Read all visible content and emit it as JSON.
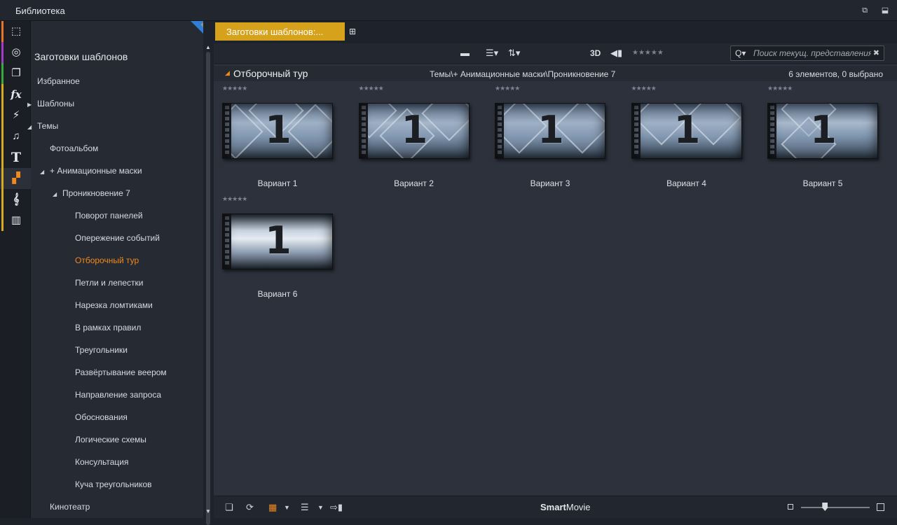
{
  "window": {
    "title": "Библиотека",
    "restore_icon": "restore-icon",
    "detach_icon": "detach-window-icon"
  },
  "categories": [
    {
      "icon": "project-box-icon",
      "glyph": "⬚",
      "color": "#e8742a"
    },
    {
      "icon": "film-reel-icon",
      "glyph": "◎",
      "color": "#a23bc8"
    },
    {
      "icon": "media-stack-icon",
      "glyph": "❐",
      "color": "#3aa83a"
    },
    {
      "icon": "effects-fx-icon",
      "glyph": "fx",
      "color": "#d7a91c"
    },
    {
      "icon": "transition-bolt-icon",
      "glyph": "⚡",
      "color": "#d7a91c"
    },
    {
      "icon": "music-note-icon",
      "glyph": "♫",
      "color": "#d7a91c"
    },
    {
      "icon": "title-text-icon",
      "glyph": "T",
      "color": "#d7a91c"
    },
    {
      "icon": "templates-icon",
      "glyph": "▞",
      "color": "#d7a91c"
    },
    {
      "icon": "score-clef-icon",
      "glyph": "𝄞",
      "color": "#d7a91c"
    },
    {
      "icon": "piano-keys-icon",
      "glyph": "▥",
      "color": "#d7a91c"
    }
  ],
  "tree": {
    "root": "Заготовки шаблонов",
    "items": [
      {
        "label": "Избранное",
        "level": 0,
        "arrow": ""
      },
      {
        "label": "Шаблоны",
        "level": 0,
        "arrow": "▶"
      },
      {
        "label": "Темы",
        "level": 0,
        "arrow": "◢"
      },
      {
        "label": "Фотоальбом",
        "level": 1,
        "arrow": ""
      },
      {
        "label": "+ Анимационные маски",
        "level": 1,
        "arrow": "◢"
      },
      {
        "label": "Проникновение 7",
        "level": 2,
        "arrow": "◢"
      },
      {
        "label": "Поворот панелей",
        "level": 3,
        "arrow": ""
      },
      {
        "label": "Опережение событий",
        "level": 3,
        "arrow": ""
      },
      {
        "label": "Отборочный тур",
        "level": 3,
        "arrow": "",
        "selected": true
      },
      {
        "label": "Петли и лепестки",
        "level": 3,
        "arrow": ""
      },
      {
        "label": "Нарезка ломтиками",
        "level": 3,
        "arrow": ""
      },
      {
        "label": "В рамках правил",
        "level": 3,
        "arrow": ""
      },
      {
        "label": "Треугольники",
        "level": 3,
        "arrow": ""
      },
      {
        "label": "Развёртывание веером",
        "level": 3,
        "arrow": ""
      },
      {
        "label": "Направление запроса",
        "level": 3,
        "arrow": ""
      },
      {
        "label": "Обоснования",
        "level": 3,
        "arrow": ""
      },
      {
        "label": "Логические схемы",
        "level": 3,
        "arrow": ""
      },
      {
        "label": "Консультация",
        "level": 3,
        "arrow": ""
      },
      {
        "label": "Куча треугольников",
        "level": 3,
        "arrow": ""
      },
      {
        "label": "Кинотеатр",
        "level": 1,
        "arrow": ""
      }
    ]
  },
  "tabs": {
    "active_label": "Заготовки шаблонов:...",
    "pin_icon": "pin-tab-icon"
  },
  "toolbar": {
    "folder_icon": "folder-icon",
    "list_icon": "list-view-icon",
    "sort_icon": "sort-icon",
    "label_3d": "3D",
    "tag_icon": "tag-icon",
    "rating_stars": "★★★★★",
    "search_placeholder": "Поиск текущ. представления",
    "search_glyph": "Q▾",
    "clear_glyph": "✖"
  },
  "group": {
    "title": "Отборочный тур",
    "path": "Темы\\+ Анимационные маски\\Проникновение 7",
    "count": "6 элементов, 0 выбрано"
  },
  "items": [
    {
      "label": "Вариант 1",
      "stars": "★★★★★",
      "number": "1"
    },
    {
      "label": "Вариант 2",
      "stars": "★★★★★",
      "number": "1"
    },
    {
      "label": "Вариант 3",
      "stars": "★★★★★",
      "number": "1"
    },
    {
      "label": "Вариант 4",
      "stars": "★★★★★",
      "number": "1"
    },
    {
      "label": "Вариант 5",
      "stars": "★★★★★",
      "number": "1"
    },
    {
      "label": "Вариант 6",
      "stars": "★★★★★",
      "number": "1"
    }
  ],
  "bottom": {
    "brand_bold": "Smart",
    "brand_rest": "Movie",
    "zoom_level": 0.35
  },
  "colors": {
    "accent": "#f08a1c",
    "tab_active": "#d6a21c",
    "selection_corner": "#2f7fd4"
  }
}
